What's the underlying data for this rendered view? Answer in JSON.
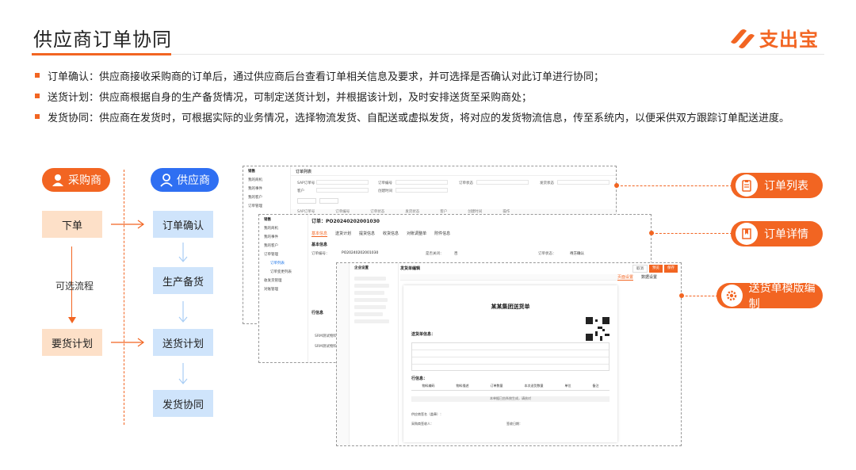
{
  "page": {
    "title": "供应商订单协同"
  },
  "logo": {
    "text": "支出宝",
    "icon": "zhichubao-logo-icon"
  },
  "bullets": [
    {
      "key": "订单确认：",
      "text": "供应商接收采购商的订单后，通过供应商后台查看订单相关信息及要求，并可选择是否确认对此订单进行协同；"
    },
    {
      "key": "送货计划：",
      "text": "供应商根据自身的生产备货情况，可制定送货计划，并根据该计划，及时安排送货至采购商处；"
    },
    {
      "key": "发货协同：",
      "text": "供应商在发货时，可根据实际的业务情况，选择物流发货、自配送或虚拟发货，将对应的发货物流信息，传至系统内，以便采供双方跟踪订单配送进度。"
    }
  ],
  "flow": {
    "buyer": {
      "label": "采购商",
      "icon": "buyer-avatar-icon"
    },
    "supplier": {
      "label": "供应商",
      "icon": "supplier-avatar-icon"
    },
    "buyer_steps": [
      "下单",
      "要货计划"
    ],
    "optional_label": "可选流程",
    "supplier_steps": [
      "订单确认",
      "生产备货",
      "送货计划",
      "发货协同"
    ]
  },
  "screens": {
    "list": {
      "sidebar_title": "销售",
      "header": "订单列表",
      "side_items": [
        "我的商机",
        "我的事件",
        "我的客户",
        "订单管理"
      ],
      "filters": [
        "SAP订单号",
        "订单编号",
        "订单状态",
        "发货状态",
        "客户",
        "创建时间"
      ],
      "columns": [
        "SAP订单号",
        "订单编号",
        "订单状态",
        "发货状态",
        "客户",
        "创建时间",
        "操作"
      ]
    },
    "detail": {
      "sidebar_title": "销售",
      "order_label": "订单：",
      "order_no": "PO20240202001030",
      "side_items": [
        "我的商机",
        "我的事件",
        "我的客户",
        "订单管理",
        "订单列表",
        "订单变更列表",
        "收发货管理",
        "对账管理"
      ],
      "tabs": [
        "基本信息",
        "送货计划",
        "提货信息",
        "收货信息",
        "对账调整单",
        "附件信息"
      ],
      "section_basic": "基本信息",
      "field_order_no_label": "订单编号：",
      "field_closed_label": "是否关闭：",
      "field_closed_value": "否",
      "field_status_label": "订单状态：",
      "field_status_value": "待方确认",
      "section_lines": "行信息",
      "line_items": [
        "SRM测试物料",
        "SRM测试物料"
      ]
    },
    "template": {
      "sidebar_title": "企业设置",
      "header": "发货单编辑",
      "doc_title": "某某集团送货单",
      "basic_title": "送货单信息：",
      "lines_title": "行信息：",
      "line_cols": [
        "物料编码",
        "物料描述",
        "订单数量",
        "本次送货数量",
        "单位",
        "备注"
      ],
      "footer_note": "本单据已由系统生成，请核对",
      "tabs_right": [
        "页面设置",
        "数据设置"
      ],
      "buttons": [
        "取消",
        "预览",
        "保存"
      ],
      "sign_labels": [
        "供应商签名（盖章）：",
        "采购商签收人：",
        "签收日期："
      ]
    }
  },
  "callouts": [
    {
      "label": "订单列表",
      "icon": "clipboard-list-icon"
    },
    {
      "label": "订单详情",
      "icon": "bookmark-doc-icon"
    },
    {
      "label": "送货单模版编制",
      "icon": "gear-icon"
    }
  ],
  "colors": {
    "accent": "#f26522",
    "blue": "#2f6ff2",
    "peach": "#fde0c8",
    "light_blue": "#cfe4fb"
  }
}
